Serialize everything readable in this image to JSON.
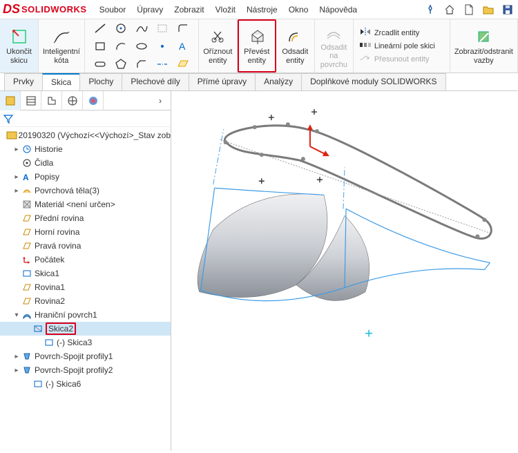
{
  "logo": {
    "ds": "DS",
    "text": "SOLIDWORKS"
  },
  "menu": [
    "Soubor",
    "Úpravy",
    "Zobrazit",
    "Vložit",
    "Nástroje",
    "Okno",
    "Nápověda"
  ],
  "ribbon": {
    "exit_sketch": "Ukončit\nskicu",
    "smart_dim": "Inteligentní\nkóta",
    "trim": "Oříznout\nentity",
    "convert": "Převést\nentity",
    "offset": "Odsadit\nentity",
    "offset_surf": "Odsadit\nna\npovrchu",
    "mirror": "Zrcadlit entity",
    "linear": "Lineární pole skici",
    "move": "Přesunout entity",
    "display": "Zobrazit/odstranit\nvazby"
  },
  "cmdtabs": [
    "Prvky",
    "Skica",
    "Plochy",
    "Plechové díly",
    "Přímé úpravy",
    "Analýzy",
    "Doplňkové moduly SOLIDWORKS"
  ],
  "tree": {
    "root": "20190320  (Výchozí<<Výchozí>_Stav zob",
    "history": "Historie",
    "sensors": "Čidla",
    "annotations": "Popisy",
    "surface_bodies": "Povrchová těla(3)",
    "material": "Materiál <není určen>",
    "front": "Přední rovina",
    "top": "Horní rovina",
    "right": "Pravá rovina",
    "origin": "Počátek",
    "sketch1": "Skica1",
    "plane1": "Rovina1",
    "plane2": "Rovina2",
    "boundary1": "Hraniční povrch1",
    "sketch2": "Skica2",
    "sketch3": "(-) Skica3",
    "loft1": "Povrch-Spojit profily1",
    "loft2": "Povrch-Spojit profily2",
    "sketch6": "(-) Skica6"
  }
}
